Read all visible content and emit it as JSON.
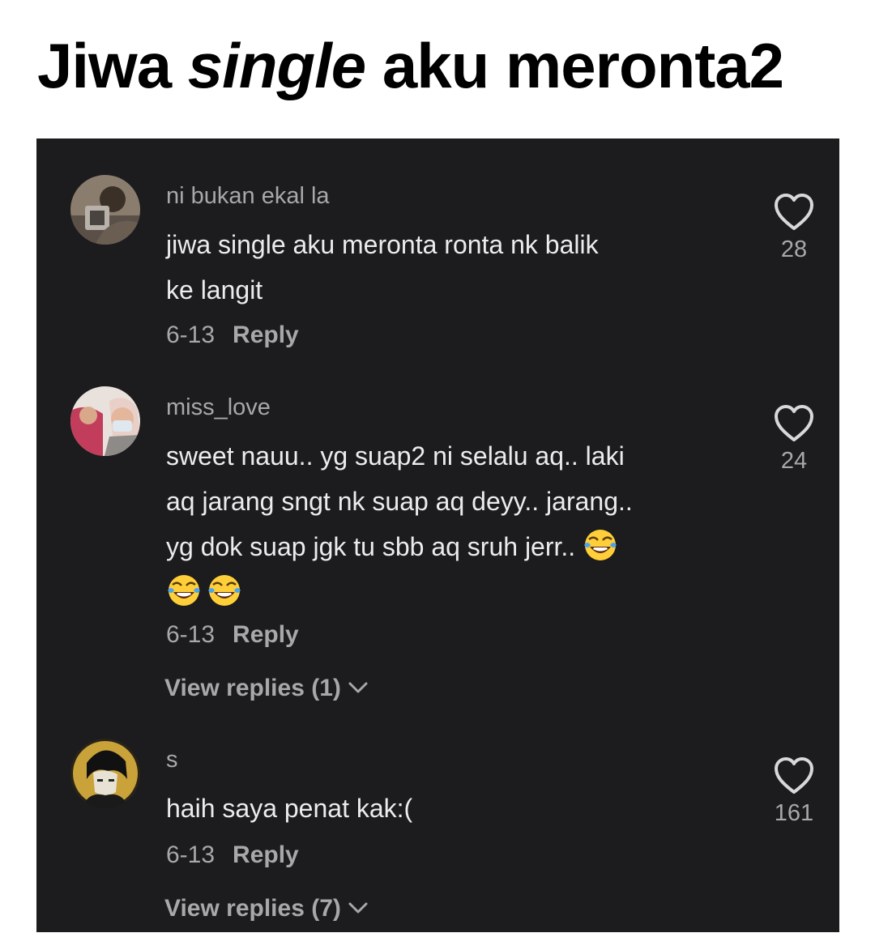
{
  "headline": {
    "before": "Jiwa ",
    "italic": "single",
    "after": " aku meronta2"
  },
  "comments": [
    {
      "username": "ni bukan ekal la",
      "lines": [
        "jiwa single aku meronta ronta nk balik",
        "ke langit"
      ],
      "date": "6-13",
      "reply_label": "Reply",
      "likes": "28"
    },
    {
      "username": "miss_love",
      "lines": [
        "sweet nauu.. yg suap2 ni selalu aq.. laki",
        "aq jarang sngt nk suap aq deyy.. jarang..",
        "yg dok suap jgk tu sbb aq sruh jerr.."
      ],
      "emoji": "face-with-tears-of-joy",
      "date": "6-13",
      "reply_label": "Reply",
      "view_replies": "View replies (1)",
      "likes": "24"
    },
    {
      "username": "s",
      "lines": [
        "haih saya penat kak:("
      ],
      "date": "6-13",
      "reply_label": "Reply",
      "view_replies": "View replies (7)",
      "likes": "161"
    }
  ],
  "colors": {
    "panel_bg": "#1c1c1e",
    "text": "#ececee",
    "muted": "#a8a8aa"
  },
  "icons": {
    "like": "heart-outline-icon",
    "expand": "chevron-down-icon"
  }
}
